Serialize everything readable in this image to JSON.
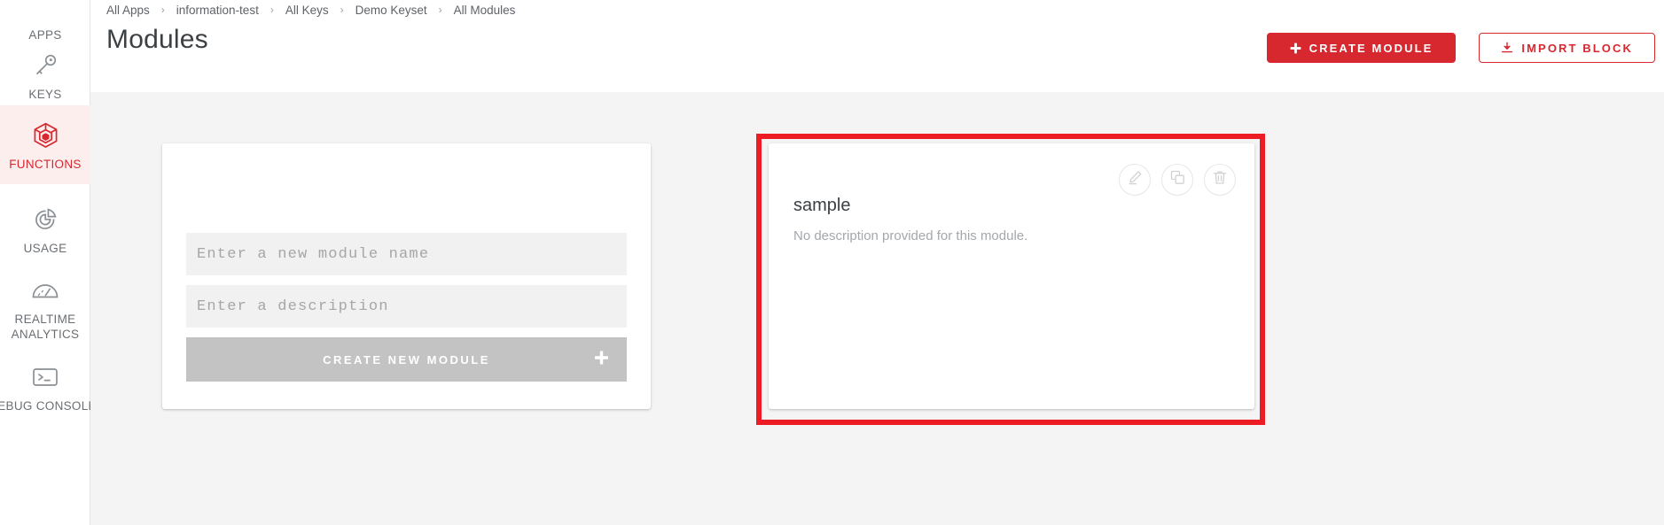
{
  "sidebar": {
    "items": [
      {
        "id": "apps",
        "label": "APPS",
        "icon": "apps-icon",
        "active": false
      },
      {
        "id": "keys",
        "label": "KEYS",
        "icon": "key-icon",
        "active": false
      },
      {
        "id": "functions",
        "label": "FUNCTIONS",
        "icon": "function-cube-icon",
        "active": true
      },
      {
        "id": "usage",
        "label": "USAGE",
        "icon": "pie-chart-icon",
        "active": false
      },
      {
        "id": "realtime",
        "label": "REALTIME\nANALYTICS",
        "label_line1": "REALTIME",
        "label_line2": "ANALYTICS",
        "icon": "gauge-icon",
        "active": false
      },
      {
        "id": "debug",
        "label": "DEBUG CONSOLE",
        "icon": "terminal-icon",
        "active": false
      }
    ],
    "active_color": "#d7282f",
    "active_bg": "#fdeeee",
    "label_color": "#6b6f73"
  },
  "header": {
    "breadcrumb": [
      {
        "label": "All Apps"
      },
      {
        "label": "information-test"
      },
      {
        "label": "All Keys"
      },
      {
        "label": "Demo Keyset"
      },
      {
        "label": "All Modules"
      }
    ],
    "breadcrumb_separator": "›",
    "title": "Modules",
    "actions": {
      "create_module": {
        "label": "CREATE MODULE",
        "icon": "plus-icon",
        "style": "primary",
        "color": "#d7282f"
      },
      "import_block": {
        "label": "IMPORT BLOCK",
        "icon": "import-download-icon",
        "style": "outline",
        "color": "#d7282f"
      }
    }
  },
  "create_panel": {
    "name_placeholder": "Enter a new module name",
    "name_value": "",
    "description_placeholder": "Enter a description",
    "description_value": "",
    "submit_label": "CREATE NEW MODULE",
    "submit_icon": "plus-icon",
    "submit_enabled": false,
    "submit_bg": "#c3c3c3"
  },
  "modules": [
    {
      "name": "sample",
      "description": "No description provided for this module.",
      "actions": [
        {
          "id": "edit",
          "icon": "pencil-edit-icon"
        },
        {
          "id": "duplicate",
          "icon": "copy-duplicate-icon"
        },
        {
          "id": "delete",
          "icon": "trash-delete-icon"
        }
      ]
    }
  ],
  "highlight": {
    "name": "module-card-highlight",
    "color": "#ed1c24",
    "border_width_px": 6
  },
  "colors": {
    "page_bg": "#f4f4f4",
    "card_bg": "#ffffff",
    "brand_red": "#d7282f",
    "text_primary": "#3c4043",
    "text_muted": "#a3a8ad",
    "field_bg": "#f1f1f1"
  }
}
